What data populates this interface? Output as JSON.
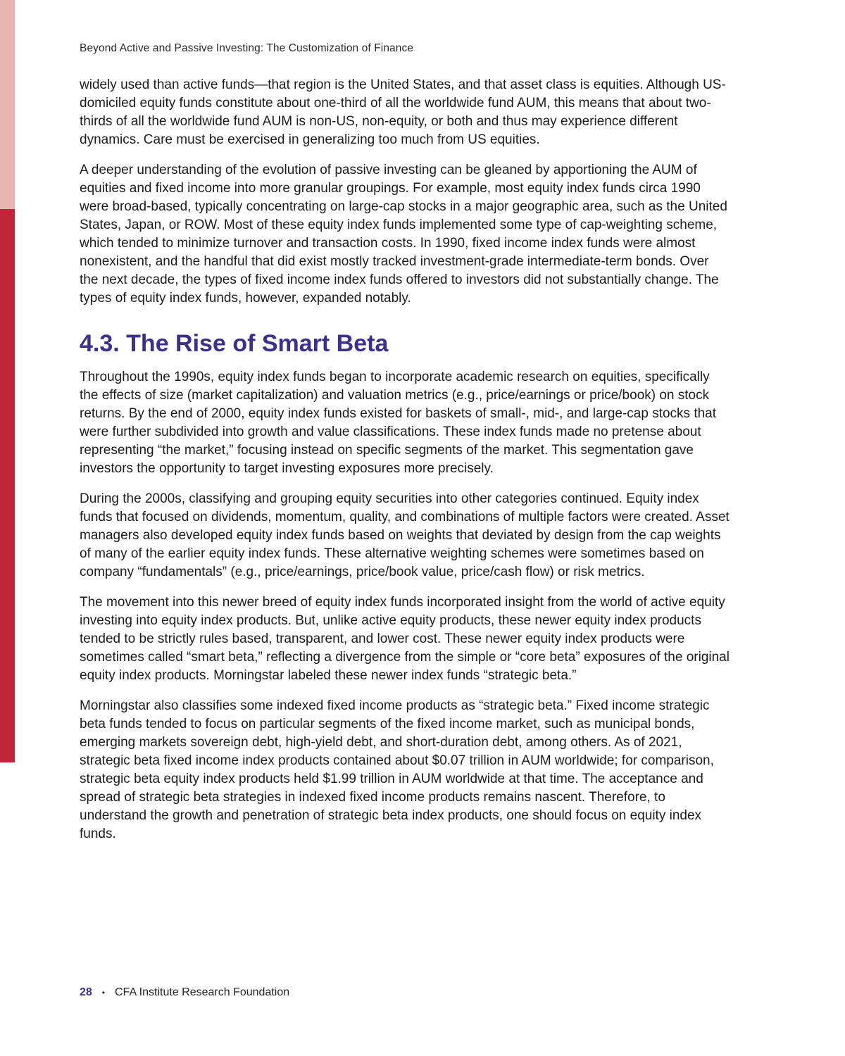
{
  "header": {
    "running_title": "Beyond Active and Passive Investing: The Customization of Finance"
  },
  "paragraphs_intro": [
    "widely used than active funds—that region is the United States, and that asset class is equities. Although US-domiciled equity funds constitute about one-third of all the worldwide fund AUM, this means that about two-thirds of all the worldwide fund AUM is non-US, non-equity, or both and thus may experience different dynamics. Care must be exercised in generalizing too much from US equities.",
    "A deeper understanding of the evolution of passive investing can be gleaned by apportioning the AUM of equities and fixed income into more granular groupings. For example, most equity index funds circa 1990 were broad-based, typically concentrating on large-cap stocks in a major geographic area, such as the United States, Japan, or ROW. Most of these equity index funds implemented some type of cap-weighting scheme, which tended to minimize turnover and transaction costs. In 1990, fixed income index funds were almost nonexistent, and the handful that did exist mostly tracked investment-grade intermediate-term bonds. Over the next decade, the types of fixed income index funds offered to investors did not substantially change. The types of equity index funds, however, expanded notably."
  ],
  "section": {
    "heading": "4.3. The Rise of Smart Beta",
    "paragraphs": [
      "Throughout the 1990s, equity index funds began to incorporate academic research on equities, specifically the effects of size (market capitalization) and valuation metrics (e.g., price/earnings or price/book) on stock returns. By the end of 2000, equity index funds existed for baskets of small-, mid-, and large-cap stocks that were further subdivided into growth and value classifications. These index funds made no pretense about representing “the market,” focusing instead on specific segments of the market. This segmentation gave investors the opportunity to target investing exposures more precisely.",
      "During the 2000s, classifying and grouping equity securities into other categories continued. Equity index funds that focused on dividends, momentum, quality, and combinations of multiple factors were created. Asset managers also developed equity index funds based on weights that deviated by design from the cap weights of many of the earlier equity index funds. These alternative weighting schemes were sometimes based on company “fundamentals” (e.g., price/earnings, price/book value, price/cash flow) or risk metrics.",
      "The movement into this newer breed of equity index funds incorporated insight from the world of active equity investing into equity index products. But, unlike active equity products, these newer equity index products tended to be strictly rules based, transparent, and lower cost. These newer equity index products were sometimes called “smart beta,” reflecting a divergence from the simple or “core beta” exposures of the original equity index products. Morningstar labeled these newer index funds “strategic beta.”",
      "Morningstar also classifies some indexed fixed income products as “strategic beta.” Fixed income strategic beta funds tended to focus on particular segments of the fixed income market, such as municipal bonds, emerging markets sovereign debt, high-yield debt, and short-duration debt, among others. As of 2021, strategic beta fixed income index products contained about $0.07 trillion in AUM worldwide; for comparison, strategic beta equity index products held $1.99 trillion in AUM worldwide at that time. The acceptance and spread of strategic beta strategies in indexed fixed income products remains nascent. Therefore, to understand the growth and penetration of strategic beta index products, one should focus on equity index funds."
    ]
  },
  "footer": {
    "page_number": "28",
    "bullet": "•",
    "publisher": "CFA Institute Research Foundation"
  },
  "colors": {
    "accent_purple": "#3d2f8a",
    "sidebar_light": "#e8b4ae",
    "sidebar_dark": "#c0253a"
  }
}
